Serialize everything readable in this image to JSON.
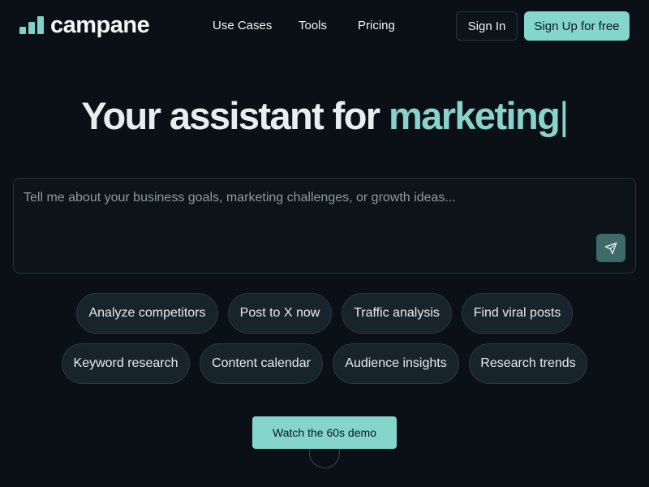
{
  "header": {
    "logo_text": "campane",
    "nav": [
      "Use Cases",
      "Tools",
      "Pricing"
    ],
    "signin_label": "Sign In",
    "signup_label": "Sign Up for free"
  },
  "hero": {
    "title_plain": "Your assistant for",
    "title_highlight": "marketing",
    "caret": "|"
  },
  "prompt": {
    "placeholder": "Tell me about your business goals, marketing challenges, or growth ideas...",
    "value": "",
    "send_icon": "send-icon"
  },
  "suggestions": [
    "Analyze competitors",
    "Post to X now",
    "Traffic analysis",
    "Find viral posts",
    "Keyword research",
    "Content calendar",
    "Audience insights",
    "Research trends"
  ],
  "demo_label": "Watch the 60s demo",
  "colors": {
    "background": "#0a1016",
    "accent": "#84d5cc",
    "chip_bg": "#18242b"
  }
}
